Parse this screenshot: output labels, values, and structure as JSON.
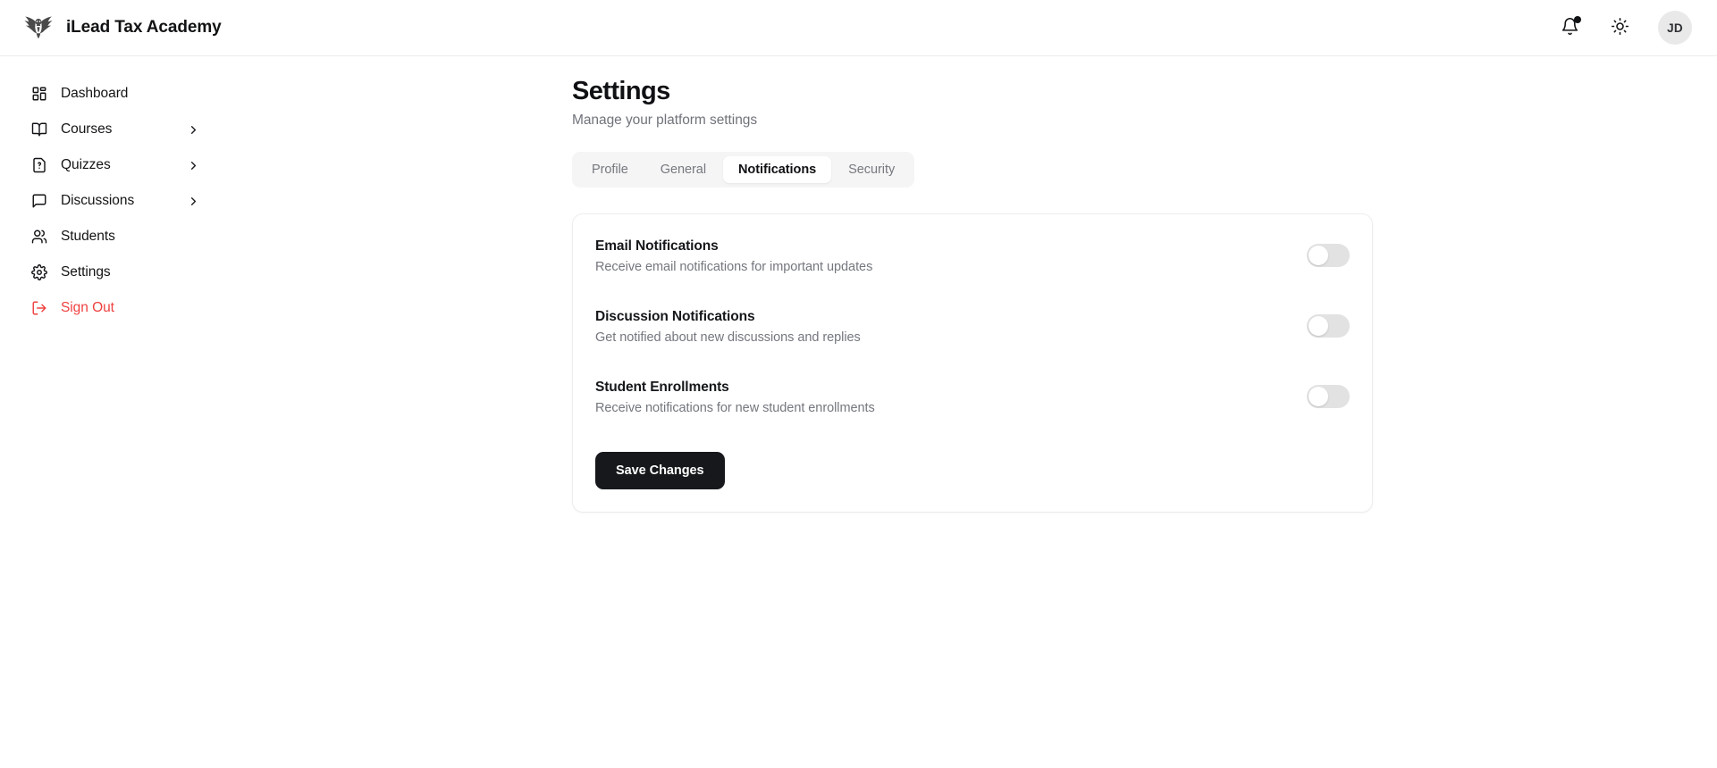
{
  "brand": {
    "name": "iLead Tax Academy",
    "logo_icon": "eagle-logo"
  },
  "topbar": {
    "notifications_icon": "bell-icon",
    "has_unread_dot": true,
    "theme_icon": "sun-icon",
    "avatar_initials": "JD"
  },
  "sidebar": {
    "items": [
      {
        "label": "Dashboard",
        "icon": "grid-icon",
        "has_chevron": false,
        "danger": false
      },
      {
        "label": "Courses",
        "icon": "book-icon",
        "has_chevron": true,
        "danger": false
      },
      {
        "label": "Quizzes",
        "icon": "file-question-icon",
        "has_chevron": true,
        "danger": false
      },
      {
        "label": "Discussions",
        "icon": "message-square-icon",
        "has_chevron": true,
        "danger": false
      },
      {
        "label": "Students",
        "icon": "users-icon",
        "has_chevron": false,
        "danger": false
      },
      {
        "label": "Settings",
        "icon": "gear-icon",
        "has_chevron": false,
        "danger": false
      },
      {
        "label": "Sign Out",
        "icon": "log-out-icon",
        "has_chevron": false,
        "danger": true
      }
    ]
  },
  "page": {
    "title": "Settings",
    "subtitle": "Manage your platform settings"
  },
  "tabs": [
    {
      "label": "Profile",
      "active": false
    },
    {
      "label": "General",
      "active": false
    },
    {
      "label": "Notifications",
      "active": true
    },
    {
      "label": "Security",
      "active": false
    }
  ],
  "notifications_panel": {
    "settings": [
      {
        "title": "Email Notifications",
        "description": "Receive email notifications for important updates",
        "enabled": false
      },
      {
        "title": "Discussion Notifications",
        "description": "Get notified about new discussions and replies",
        "enabled": false
      },
      {
        "title": "Student Enrollments",
        "description": "Receive notifications for new student enrollments",
        "enabled": false
      }
    ],
    "save_label": "Save Changes"
  },
  "colors": {
    "accent_dark": "#17181b",
    "danger": "#ef4040",
    "muted_text": "#74777e",
    "tab_bar_bg": "#f5f5f5",
    "toggle_off": "#e2e2e2"
  }
}
